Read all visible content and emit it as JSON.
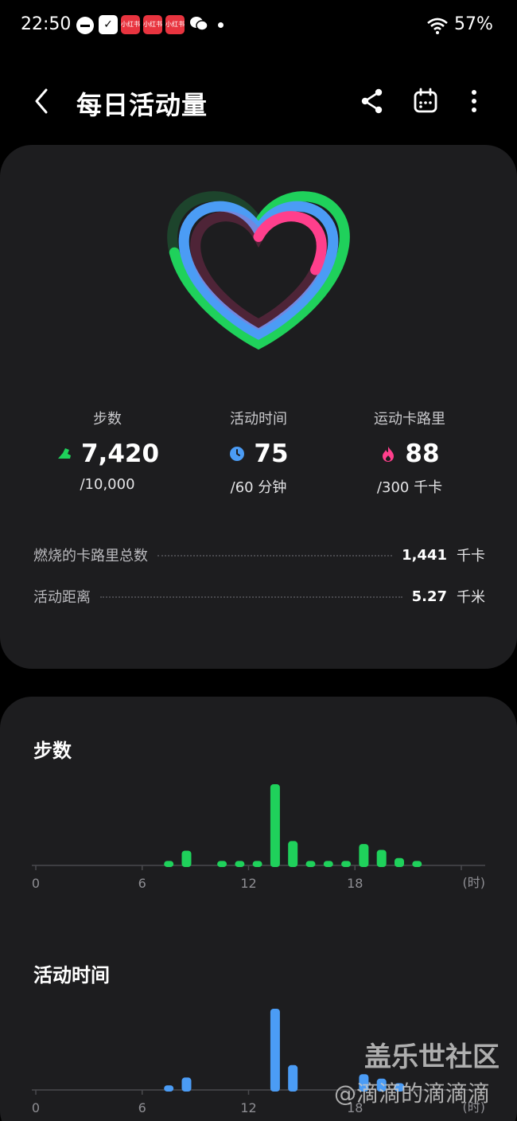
{
  "status_bar": {
    "time": "22:50",
    "battery": "57%",
    "notification_icons": [
      "dnd-icon",
      "check-app-icon",
      "xiaohongshu-icon",
      "xiaohongshu-icon",
      "xiaohongshu-icon",
      "wechat-icon"
    ],
    "app_badge_text": "小红书"
  },
  "header": {
    "title": "每日活动量"
  },
  "rings": {
    "steps_progress": 0.742,
    "active_time_progress": 1.25,
    "calories_progress": 0.293,
    "colors": {
      "steps": "#1fd15b",
      "active": "#4b9cf5",
      "calories": "#ff3f8c"
    }
  },
  "goals": [
    {
      "label": "步数",
      "value": "7,420",
      "target": "/10,000",
      "icon": "shoe-icon",
      "color": "#1fd15b"
    },
    {
      "label": "活动时间",
      "value": "75",
      "target": "/60 分钟",
      "icon": "clock-icon",
      "color": "#4b9cf5"
    },
    {
      "label": "运动卡路里",
      "value": "88",
      "target": "/300 千卡",
      "icon": "flame-icon",
      "color": "#ff3f8c"
    }
  ],
  "stats": [
    {
      "label": "燃烧的卡路里总数",
      "value": "1,441",
      "unit": "千卡"
    },
    {
      "label": "活动距离",
      "value": "5.27",
      "unit": "千米"
    }
  ],
  "chart_data": [
    {
      "type": "bar",
      "title": "步数",
      "color": "#1fd15b",
      "x_ticks": [
        "0",
        "6",
        "12",
        "18"
      ],
      "x_unit": "(时)",
      "hours": [
        7,
        8,
        10,
        11,
        12,
        13,
        14,
        15,
        16,
        17,
        18,
        19,
        20,
        21
      ],
      "values": [
        60,
        200,
        60,
        60,
        60,
        1100,
        330,
        60,
        60,
        60,
        290,
        210,
        100,
        60
      ]
    },
    {
      "type": "bar",
      "title": "活动时间",
      "color": "#4b9cf5",
      "x_ticks": [
        "0",
        "6",
        "12",
        "18"
      ],
      "x_unit": "(时)",
      "hours": [
        7,
        8,
        13,
        14,
        18,
        19,
        20
      ],
      "values": [
        4,
        11,
        72,
        22,
        14,
        10,
        6
      ]
    }
  ],
  "watermark": {
    "line1": "盖乐世社区",
    "line2": "@滴滴的滴滴滴"
  }
}
